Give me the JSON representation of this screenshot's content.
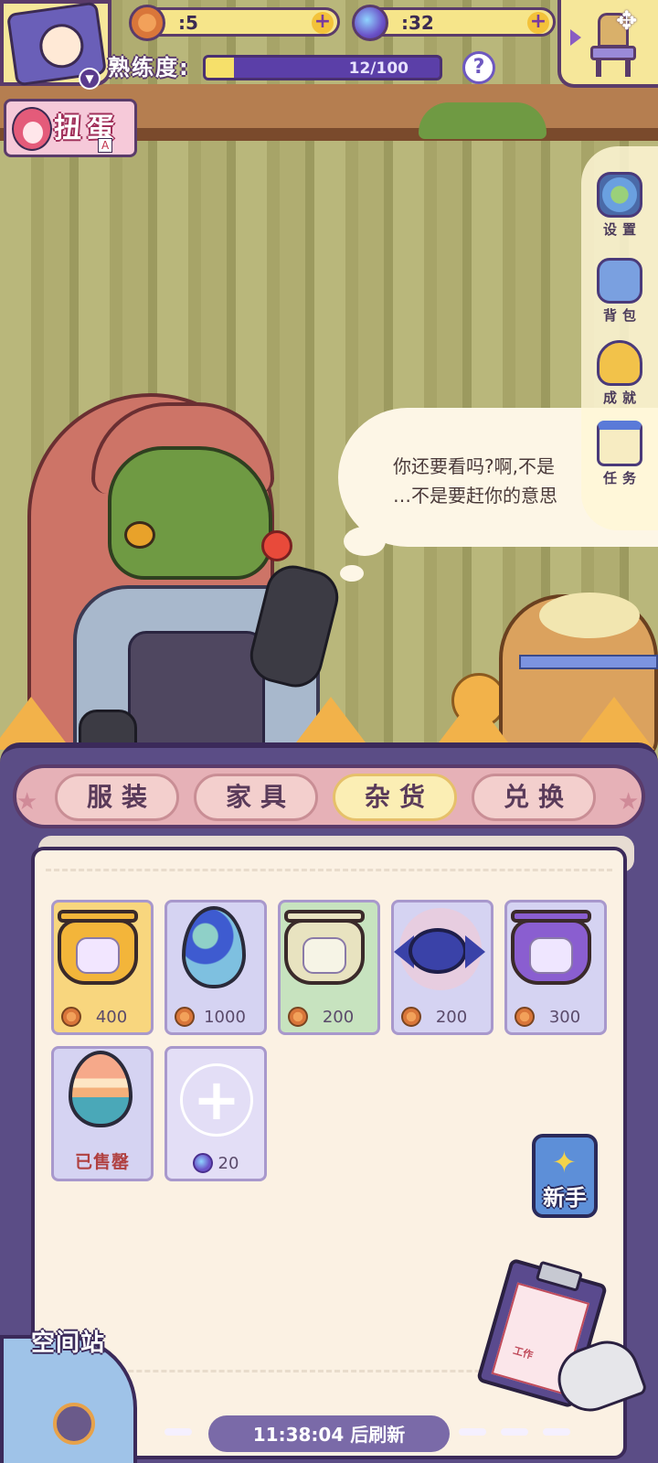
{
  "hud": {
    "coins": ":5",
    "planets": ":32",
    "proficiency_label": "熟练度:",
    "proficiency_value": "12/100",
    "proficiency_ratio": 0.12,
    "help": "?",
    "gacha_label": "扭蛋",
    "gacha_sub": "A"
  },
  "side_menu": {
    "settings": "设置",
    "backpack": "背包",
    "achievements": "成就",
    "tasks": "任务"
  },
  "dialog": {
    "line1": "你还要看吗?啊,不是",
    "line2": "…不是要赶你的意思"
  },
  "tabs": [
    "服装",
    "家具",
    "杂货",
    "兑换"
  ],
  "active_tab": 2,
  "items": [
    {
      "price": "400",
      "currency": "coin"
    },
    {
      "price": "1000",
      "currency": "coin"
    },
    {
      "price": "200",
      "currency": "coin"
    },
    {
      "price": "200",
      "currency": "coin"
    },
    {
      "price": "300",
      "currency": "coin"
    },
    {
      "status": "已售罄"
    },
    {
      "price": "20",
      "currency": "planet"
    }
  ],
  "newbie_label": "新手",
  "clipboard_label": "工作",
  "space_station": "空间站",
  "refresh": {
    "time": "11:38:04",
    "suffix": "后刷新"
  }
}
